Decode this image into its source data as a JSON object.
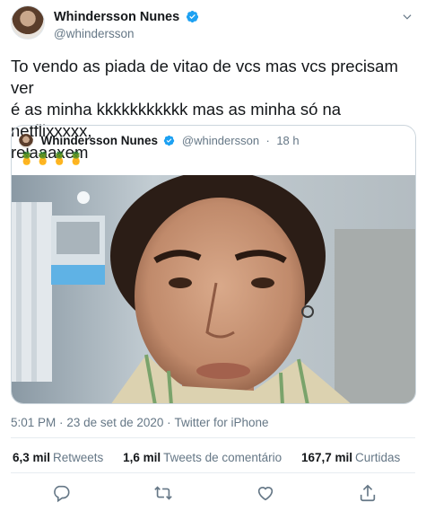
{
  "tweet": {
    "author_name": "Whindersson Nunes",
    "author_handle": "@whindersson",
    "text": "To vendo as piada de vitao de vcs mas vcs precisam ver\né as minha kkkkkkkkkkk mas as minha só na netflixxxxx,\nrelaaaxem",
    "timestamp": "5:01 PM",
    "separator": "·",
    "date": "23 de set de 2020",
    "source": "Twitter for iPhone"
  },
  "quote": {
    "author_name": "Whindersson Nunes",
    "author_handle": "@whindersson",
    "separator": "·",
    "time": "18 h",
    "text": "🍍🍍🍍🍍"
  },
  "stats": [
    {
      "number": "6,3 mil",
      "label": "Retweets"
    },
    {
      "number": "1,6 mil",
      "label": "Tweets de comentário"
    },
    {
      "number": "167,7 mil",
      "label": "Curtidas"
    }
  ],
  "actions": [
    {
      "icon": "reply-icon"
    },
    {
      "icon": "retweet-icon"
    },
    {
      "icon": "like-icon"
    },
    {
      "icon": "share-icon"
    }
  ],
  "colors": {
    "verified": "#1da1f2",
    "secondary_text": "#657786",
    "border": "#e6ecf0"
  }
}
